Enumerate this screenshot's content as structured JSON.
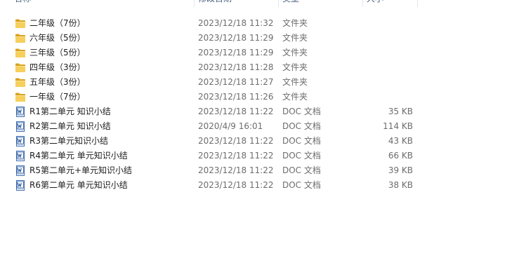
{
  "columns": {
    "name": "名称",
    "date": "修改日期",
    "type": "类型",
    "size": "大小"
  },
  "files": [
    {
      "name": "二年级（7份）",
      "date": "2023/12/18 11:32",
      "type": "文件夹",
      "size": "",
      "icon": "folder-icon"
    },
    {
      "name": "六年级（5份）",
      "date": "2023/12/18 11:29",
      "type": "文件夹",
      "size": "",
      "icon": "folder-icon"
    },
    {
      "name": "三年级（5份）",
      "date": "2023/12/18 11:29",
      "type": "文件夹",
      "size": "",
      "icon": "folder-icon"
    },
    {
      "name": "四年级（3份）",
      "date": "2023/12/18 11:28",
      "type": "文件夹",
      "size": "",
      "icon": "folder-icon"
    },
    {
      "name": "五年级（3份）",
      "date": "2023/12/18 11:27",
      "type": "文件夹",
      "size": "",
      "icon": "folder-icon"
    },
    {
      "name": "一年级（7份）",
      "date": "2023/12/18 11:26",
      "type": "文件夹",
      "size": "",
      "icon": "folder-icon"
    },
    {
      "name": "R1第二单元 知识小结",
      "date": "2023/12/18 11:22",
      "type": "DOC 文档",
      "size": "35 KB",
      "icon": "word-doc-icon"
    },
    {
      "name": "R2第二单元 知识小结",
      "date": "2020/4/9 16:01",
      "type": "DOC 文档",
      "size": "114 KB",
      "icon": "word-doc-icon"
    },
    {
      "name": "R3第二单元知识小结",
      "date": "2023/12/18 11:22",
      "type": "DOC 文档",
      "size": "43 KB",
      "icon": "word-doc-icon"
    },
    {
      "name": "R4第二单元 单元知识小结",
      "date": "2023/12/18 11:22",
      "type": "DOC 文档",
      "size": "66 KB",
      "icon": "word-doc-icon"
    },
    {
      "name": "R5第二单元+单元知识小结",
      "date": "2023/12/18 11:22",
      "type": "DOC 文档",
      "size": "39 KB",
      "icon": "word-doc-icon"
    },
    {
      "name": "R6第二单元 单元知识小结",
      "date": "2023/12/18 11:22",
      "type": "DOC 文档",
      "size": "38 KB",
      "icon": "word-doc-icon"
    }
  ]
}
